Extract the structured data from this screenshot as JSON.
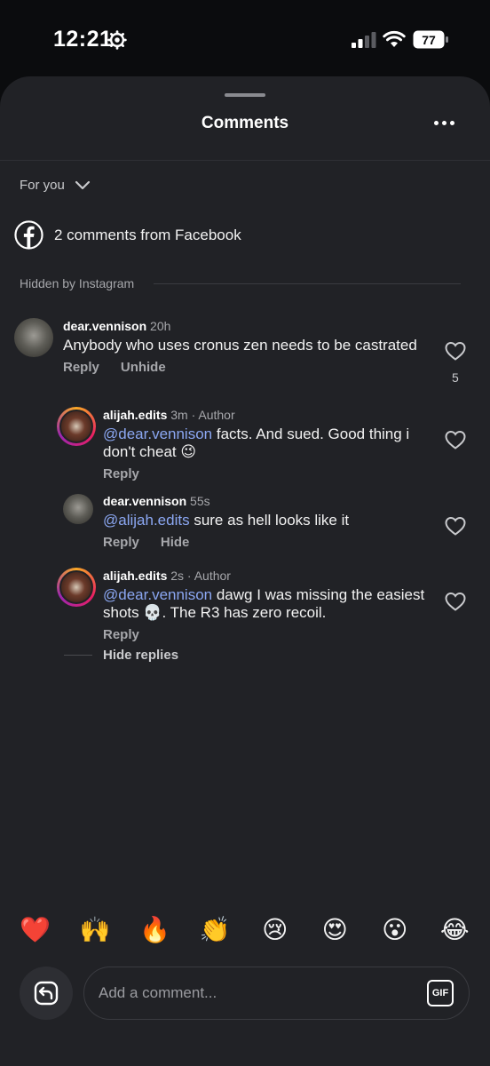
{
  "status_bar": {
    "time": "12:21",
    "battery": "77"
  },
  "sheet": {
    "title": "Comments"
  },
  "sort": {
    "label": "For you"
  },
  "facebook": {
    "text": "2 comments from Facebook"
  },
  "hidden_section": {
    "label": "Hidden by Instagram"
  },
  "comments": [
    {
      "username": "dear.vennison",
      "time": "20h",
      "text": "Anybody who uses cronus zen needs to be castrated",
      "actions": [
        "Reply",
        "Unhide"
      ],
      "likes": "5"
    }
  ],
  "replies": [
    {
      "username": "alijah.edits",
      "time": "3m · Author",
      "mention": "@dear.vennison",
      "text": " facts. And sued. Good thing i don't cheat 😉",
      "actions": [
        "Reply"
      ]
    },
    {
      "username": "dear.vennison",
      "time": "55s",
      "mention": "@alijah.edits",
      "text": " sure as hell looks like it",
      "actions": [
        "Reply",
        "Hide"
      ]
    },
    {
      "username": "alijah.edits",
      "time": "2s · Author",
      "mention": "@dear.vennison",
      "text": " dawg I was missing the easiest shots 💀. The R3 has zero recoil.",
      "actions": [
        "Reply"
      ]
    }
  ],
  "hide_replies": "Hide replies",
  "emoji_bar": [
    "❤️",
    "🙌",
    "🔥",
    "👏",
    "😢",
    "😍",
    "😮",
    "😂"
  ],
  "composer": {
    "placeholder": "Add a comment...",
    "gif_label": "GIF"
  }
}
